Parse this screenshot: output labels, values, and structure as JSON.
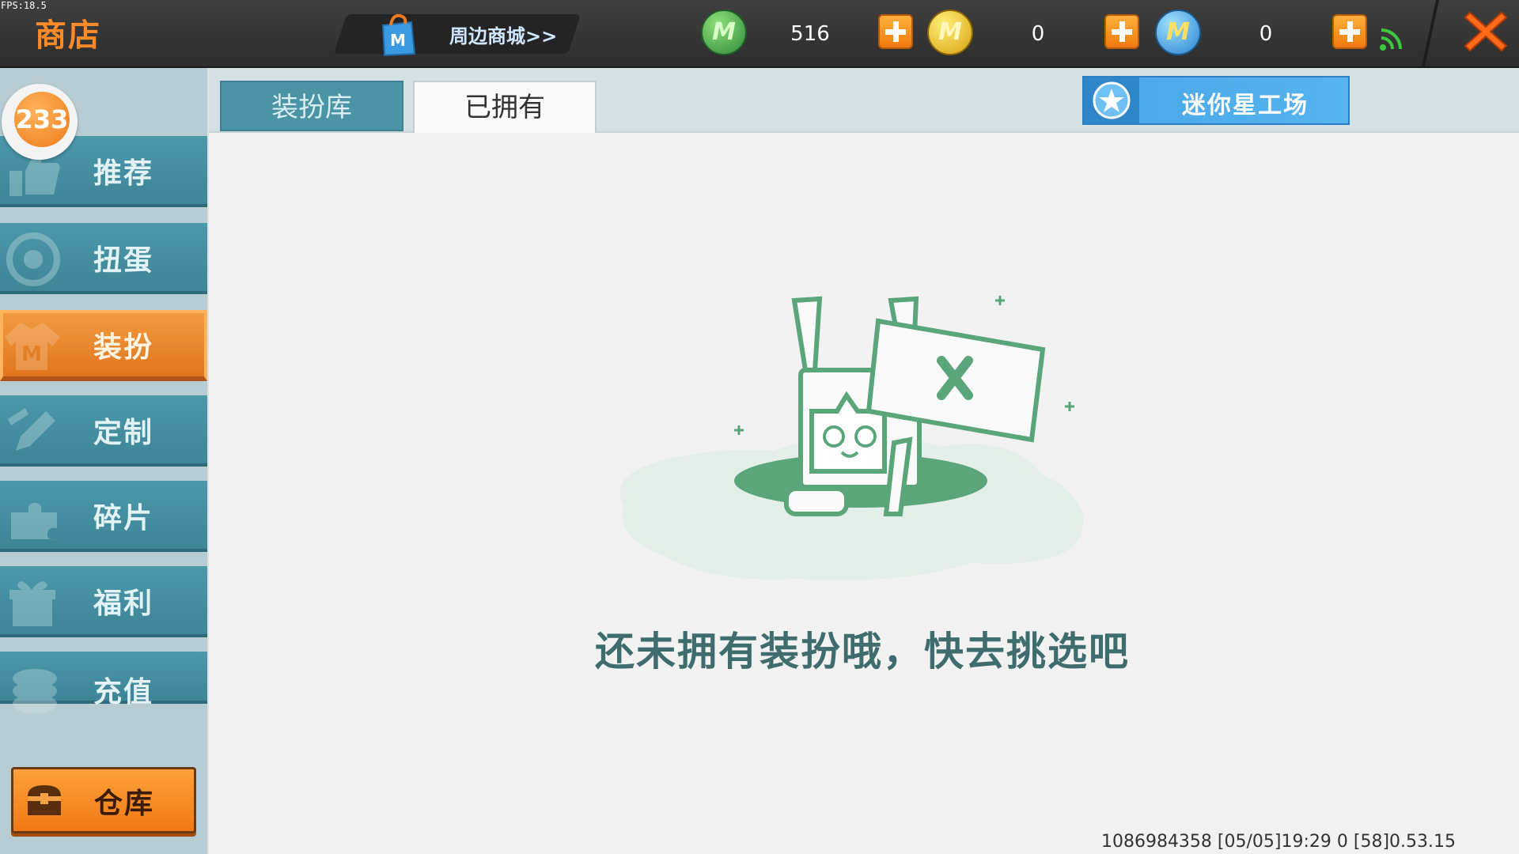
{
  "debug": {
    "fps": "FPS:18.5"
  },
  "header": {
    "title": "商店",
    "mall_link": "周边商城>>",
    "currencies": [
      {
        "name": "mini-bean",
        "icon": "green-m-coin-icon",
        "value": "516",
        "color": "#3aa84a"
      },
      {
        "name": "mini-coin",
        "icon": "gold-m-coin-icon",
        "value": "0",
        "color": "#f0c020"
      },
      {
        "name": "mini-point",
        "icon": "blue-m-coin-icon",
        "value": "0",
        "color": "#3aa0e8"
      }
    ],
    "close_icon": "close-x-icon"
  },
  "sidebar": {
    "badge": "233",
    "items": [
      {
        "label": "推荐",
        "icon": "thumbs-up-icon",
        "active": false
      },
      {
        "label": "扭蛋",
        "icon": "capsule-icon",
        "active": false
      },
      {
        "label": "装扮",
        "icon": "shirt-icon",
        "active": true
      },
      {
        "label": "定制",
        "icon": "pencil-icon",
        "active": false
      },
      {
        "label": "碎片",
        "icon": "puzzle-icon",
        "active": false
      },
      {
        "label": "福利",
        "icon": "gift-icon",
        "active": false
      },
      {
        "label": "充值",
        "icon": "coins-icon",
        "active": false
      }
    ],
    "warehouse_label": "仓库"
  },
  "tabs": [
    {
      "label": "装扮库",
      "active": false
    },
    {
      "label": "已拥有",
      "active": true
    }
  ],
  "workshop_label": "迷你星工场",
  "main": {
    "empty_message": "还未拥有装扮哦，快去挑选吧"
  },
  "footer": {
    "info": "1086984358  [05/05]19:29 0 [58]0.53.15"
  },
  "colors": {
    "accent_orange": "#f08a2a",
    "teal": "#4a94a6",
    "illustration_green": "#5aa57a"
  }
}
